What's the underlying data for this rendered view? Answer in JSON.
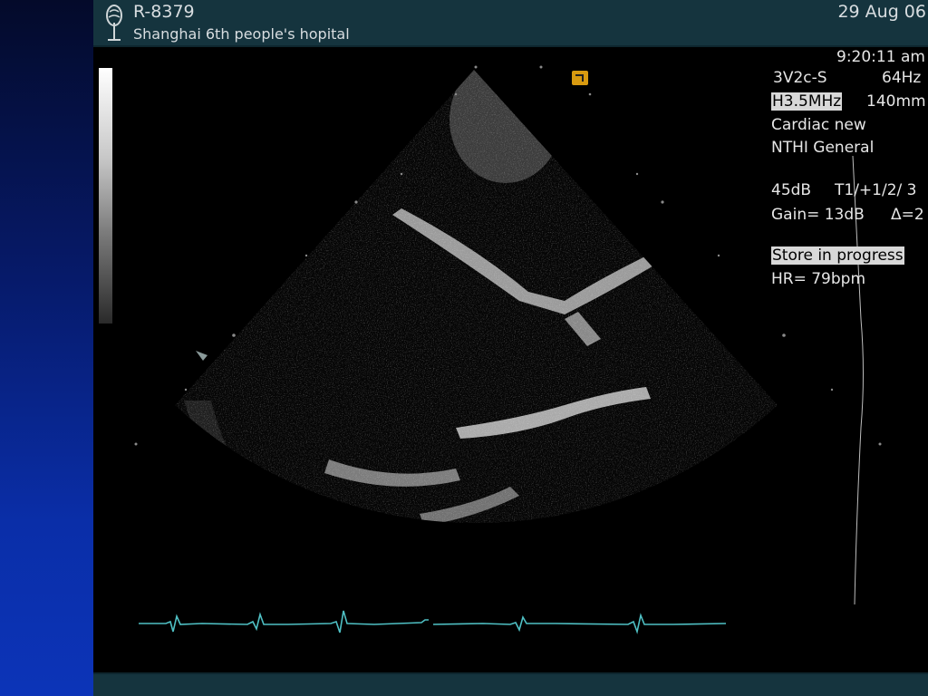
{
  "header": {
    "patient_id": "R-8379",
    "hospital": "Shanghai 6th people's hopital",
    "date": "29 Aug 06"
  },
  "info_panel": {
    "time": "9:20:11 am",
    "probe": "3V2c-S",
    "frame_rate": "64Hz",
    "frequency": "H3.5MHz",
    "depth": "140mm",
    "preset": "Cardiac new",
    "application": "NTHI General",
    "dynamic_range": "45dB",
    "settings": "T1/+1/2/ 3",
    "gain": "Gain= 13dB",
    "delta": "Δ=2",
    "status": "Store in progress",
    "heart_rate": "HR= 79bpm"
  },
  "colors": {
    "header_bg": "#15343e",
    "ecg_trace": "#4fc0c4",
    "slide_gradient_dark": "#040a2a",
    "slide_gradient_light": "#0c34b8",
    "probe_marker": "#d89a10"
  },
  "icons": [
    "tree-logo-icon",
    "probe-orientation-marker-icon",
    "focus-arrow-icon"
  ]
}
